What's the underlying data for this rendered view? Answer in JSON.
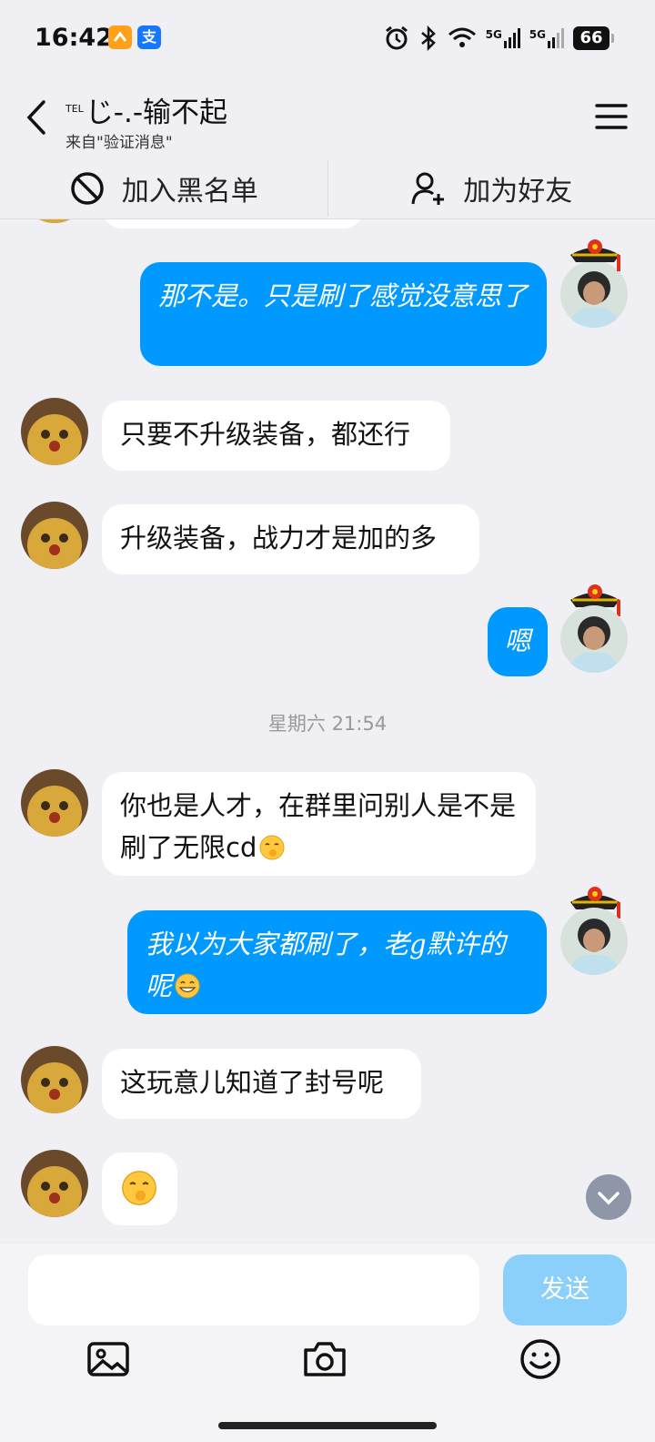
{
  "status": {
    "time": "16:42",
    "net1": "5G",
    "net2": "5G",
    "battery": "66"
  },
  "header": {
    "title_prefix": "TEL",
    "title": "じ-.-输不起",
    "subtitle": "来自\"验证消息\""
  },
  "actions": {
    "block": "加入黑名单",
    "add_friend": "加为好友"
  },
  "messages": [
    {
      "side": "out",
      "text": "那不是。只是刷了感觉没意思了"
    },
    {
      "side": "in",
      "text": "只要不升级装备，都还行"
    },
    {
      "side": "in",
      "text": "升级装备，战力才是加的多"
    },
    {
      "side": "out",
      "text": "嗯"
    },
    {
      "side": "in",
      "text": "你也是人才，在群里问别人是不是刷了无限cd"
    },
    {
      "side": "out",
      "text": "我以为大家都刷了，老g默许的呢"
    },
    {
      "side": "in",
      "text": "这玩意儿知道了封号呢"
    }
  ],
  "time_separator": "星期六 21:54",
  "composer": {
    "send_label": "发送"
  },
  "icons": {
    "back": "back-chevron-icon",
    "menu": "hamburger-menu-icon",
    "block": "block-icon",
    "add_friend": "add-user-icon",
    "scroll": "scroll-down-icon",
    "image": "image-icon",
    "camera": "camera-icon",
    "emoji": "emoji-icon"
  },
  "colors": {
    "outgoing_bubble": "#0099ff",
    "send_button": "#8bd0fb",
    "background": "#efeff4"
  }
}
